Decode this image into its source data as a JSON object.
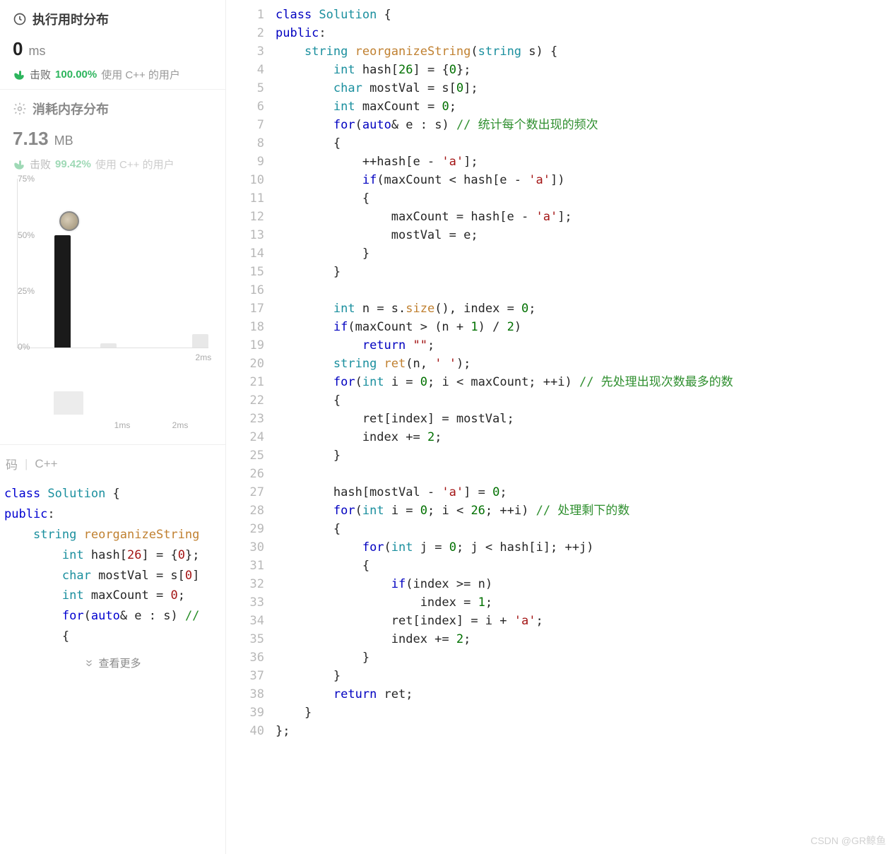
{
  "runtime": {
    "title": "执行用时分布",
    "value": "0",
    "unit": "ms",
    "beat_label": "击败",
    "beat_percent": "100.00%",
    "beat_tail": "使用 C++ 的用户"
  },
  "memory": {
    "title": "消耗内存分布",
    "value": "7.13",
    "unit": "MB",
    "beat_label": "击败",
    "beat_percent": "99.42%",
    "beat_tail": "使用 C++ 的用户"
  },
  "chart_data": {
    "type": "bar",
    "y_ticks": [
      "75%",
      "50%",
      "25%",
      "0%"
    ],
    "categories": [
      "",
      "",
      "",
      "2ms"
    ],
    "values": [
      50,
      2,
      0,
      6
    ],
    "ylim": [
      0,
      75
    ],
    "y_unit": "%",
    "avatar_on_index": 0
  },
  "mini_chart_data": {
    "type": "bar",
    "categories": [
      "",
      "1ms",
      "2ms"
    ],
    "values": [
      55,
      0,
      0
    ],
    "ylim": [
      0,
      100
    ]
  },
  "preview": {
    "lang_left": "码",
    "lang_right": "C++",
    "show_more": "查看更多",
    "lines": [
      {
        "t": "class ",
        "c": "kw-blue"
      },
      {
        "t": "Solution ",
        "c": "kw-teal"
      },
      {
        "t": "{",
        "c": ""
      }
    ]
  },
  "editor": {
    "lines": [
      [
        [
          "class ",
          "tok-kw"
        ],
        [
          "Solution",
          "tok-type"
        ],
        [
          " {",
          ""
        ]
      ],
      [
        [
          "public",
          "tok-kw"
        ],
        [
          ":",
          ""
        ]
      ],
      [
        [
          "    ",
          ""
        ],
        [
          "string ",
          "tok-type"
        ],
        [
          "reorganizeString",
          "tok-fn"
        ],
        [
          "(",
          ""
        ],
        [
          "string ",
          "tok-type"
        ],
        [
          "s) {",
          ""
        ]
      ],
      [
        [
          "        ",
          ""
        ],
        [
          "int ",
          "tok-type"
        ],
        [
          "hash[",
          ""
        ],
        [
          "26",
          "tok-num"
        ],
        [
          "] = {",
          ""
        ],
        [
          "0",
          "tok-num"
        ],
        [
          "};",
          ""
        ]
      ],
      [
        [
          "        ",
          ""
        ],
        [
          "char ",
          "tok-type"
        ],
        [
          "mostVal = s[",
          ""
        ],
        [
          "0",
          "tok-num"
        ],
        [
          "];",
          ""
        ]
      ],
      [
        [
          "        ",
          ""
        ],
        [
          "int ",
          "tok-type"
        ],
        [
          "maxCount = ",
          ""
        ],
        [
          "0",
          "tok-num"
        ],
        [
          ";",
          ""
        ]
      ],
      [
        [
          "        ",
          ""
        ],
        [
          "for",
          "tok-kw"
        ],
        [
          "(",
          ""
        ],
        [
          "auto",
          "tok-kw"
        ],
        [
          "& e : s) ",
          ""
        ],
        [
          "// 统计每个数出现的频次",
          "tok-cmt"
        ]
      ],
      [
        [
          "        {",
          ""
        ]
      ],
      [
        [
          "            ++hash[e - ",
          ""
        ],
        [
          "'a'",
          "tok-str"
        ],
        [
          "];",
          ""
        ]
      ],
      [
        [
          "            ",
          ""
        ],
        [
          "if",
          "tok-kw"
        ],
        [
          "(maxCount < hash[e - ",
          ""
        ],
        [
          "'a'",
          "tok-str"
        ],
        [
          "])",
          ""
        ]
      ],
      [
        [
          "            {",
          ""
        ]
      ],
      [
        [
          "                maxCount = hash[e - ",
          ""
        ],
        [
          "'a'",
          "tok-str"
        ],
        [
          "];",
          ""
        ]
      ],
      [
        [
          "                mostVal = e;",
          ""
        ]
      ],
      [
        [
          "            }",
          ""
        ]
      ],
      [
        [
          "        }",
          ""
        ]
      ],
      [
        [
          "",
          ""
        ]
      ],
      [
        [
          "        ",
          ""
        ],
        [
          "int ",
          "tok-type"
        ],
        [
          "n = s.",
          ""
        ],
        [
          "size",
          "tok-fn"
        ],
        [
          "(), index = ",
          ""
        ],
        [
          "0",
          "tok-num"
        ],
        [
          ";",
          ""
        ]
      ],
      [
        [
          "        ",
          ""
        ],
        [
          "if",
          "tok-kw"
        ],
        [
          "(maxCount > (n + ",
          ""
        ],
        [
          "1",
          "tok-num"
        ],
        [
          ") / ",
          ""
        ],
        [
          "2",
          "tok-num"
        ],
        [
          ")",
          ""
        ]
      ],
      [
        [
          "            ",
          ""
        ],
        [
          "return ",
          "tok-kw"
        ],
        [
          "\"\"",
          "tok-str"
        ],
        [
          ";",
          ""
        ]
      ],
      [
        [
          "        ",
          ""
        ],
        [
          "string ",
          "tok-type"
        ],
        [
          "ret",
          "tok-fn"
        ],
        [
          "(n, ",
          ""
        ],
        [
          "' '",
          "tok-str"
        ],
        [
          ");",
          ""
        ]
      ],
      [
        [
          "        ",
          ""
        ],
        [
          "for",
          "tok-kw"
        ],
        [
          "(",
          ""
        ],
        [
          "int ",
          "tok-type"
        ],
        [
          "i = ",
          ""
        ],
        [
          "0",
          "tok-num"
        ],
        [
          "; i < maxCount; ++i) ",
          ""
        ],
        [
          "// 先处理出现次数最多的数",
          "tok-cmt"
        ]
      ],
      [
        [
          "        {",
          ""
        ]
      ],
      [
        [
          "            ret[index] = mostVal;",
          ""
        ]
      ],
      [
        [
          "            index += ",
          ""
        ],
        [
          "2",
          "tok-num"
        ],
        [
          ";",
          ""
        ]
      ],
      [
        [
          "        }",
          ""
        ]
      ],
      [
        [
          "",
          ""
        ]
      ],
      [
        [
          "        hash[mostVal - ",
          ""
        ],
        [
          "'a'",
          "tok-str"
        ],
        [
          "] = ",
          ""
        ],
        [
          "0",
          "tok-num"
        ],
        [
          ";",
          ""
        ]
      ],
      [
        [
          "        ",
          ""
        ],
        [
          "for",
          "tok-kw"
        ],
        [
          "(",
          ""
        ],
        [
          "int ",
          "tok-type"
        ],
        [
          "i = ",
          ""
        ],
        [
          "0",
          "tok-num"
        ],
        [
          "; i < ",
          ""
        ],
        [
          "26",
          "tok-num"
        ],
        [
          "; ++i) ",
          ""
        ],
        [
          "// 处理剩下的数",
          "tok-cmt"
        ]
      ],
      [
        [
          "        {",
          ""
        ]
      ],
      [
        [
          "            ",
          ""
        ],
        [
          "for",
          "tok-kw"
        ],
        [
          "(",
          ""
        ],
        [
          "int ",
          "tok-type"
        ],
        [
          "j = ",
          ""
        ],
        [
          "0",
          "tok-num"
        ],
        [
          "; j < hash[i]; ++j)",
          ""
        ]
      ],
      [
        [
          "            {",
          ""
        ]
      ],
      [
        [
          "                ",
          ""
        ],
        [
          "if",
          "tok-kw"
        ],
        [
          "(index >= n)",
          ""
        ]
      ],
      [
        [
          "                    index = ",
          ""
        ],
        [
          "1",
          "tok-num"
        ],
        [
          ";",
          ""
        ]
      ],
      [
        [
          "                ret[index] = i + ",
          ""
        ],
        [
          "'a'",
          "tok-str"
        ],
        [
          ";",
          ""
        ]
      ],
      [
        [
          "                index += ",
          ""
        ],
        [
          "2",
          "tok-num"
        ],
        [
          ";",
          ""
        ]
      ],
      [
        [
          "            }",
          ""
        ]
      ],
      [
        [
          "        }",
          ""
        ]
      ],
      [
        [
          "        ",
          ""
        ],
        [
          "return ",
          "tok-kw"
        ],
        [
          "ret;",
          ""
        ]
      ],
      [
        [
          "    }",
          ""
        ]
      ],
      [
        [
          "};",
          ""
        ]
      ]
    ]
  },
  "watermark": "CSDN @GR鲸鱼"
}
